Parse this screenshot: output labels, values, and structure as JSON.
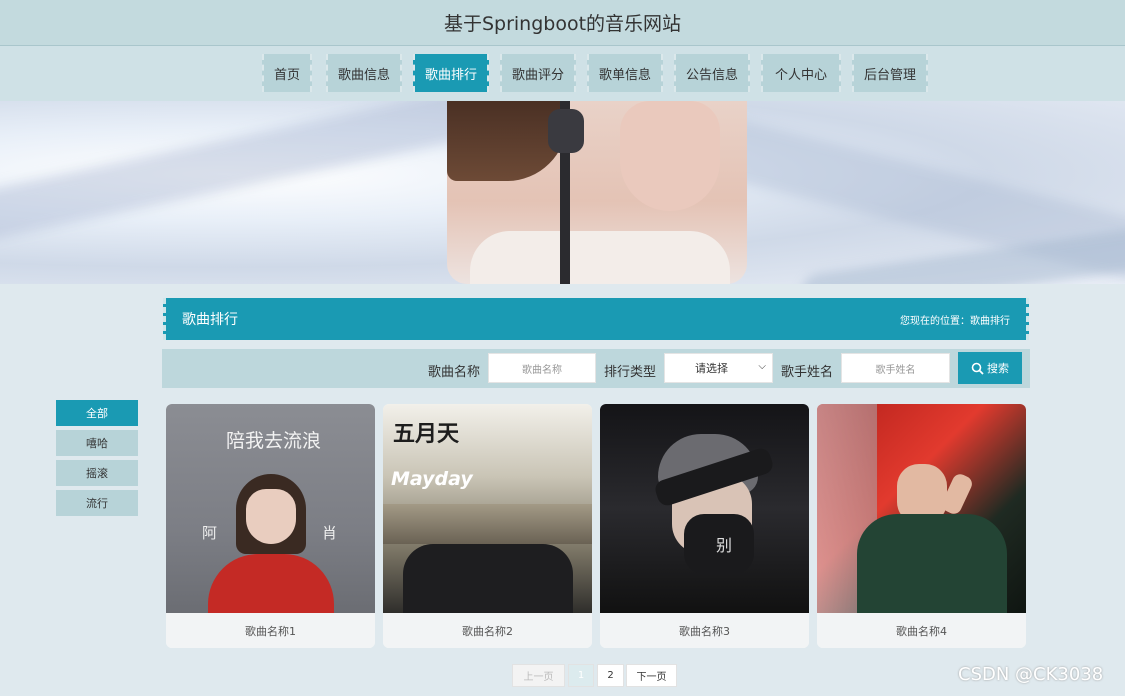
{
  "site": {
    "title": "基于Springboot的音乐网站"
  },
  "nav": {
    "items": [
      "首页",
      "歌曲信息",
      "歌曲排行",
      "歌曲评分",
      "歌单信息",
      "公告信息",
      "个人中心",
      "后台管理"
    ],
    "active": "歌曲排行"
  },
  "section": {
    "title": "歌曲排行",
    "breadcrumb": "您现在的位置：歌曲排行"
  },
  "search": {
    "song_label": "歌曲名称",
    "song_placeholder": "歌曲名称",
    "rank_label": "排行类型",
    "rank_selected": "请选择",
    "singer_label": "歌手姓名",
    "singer_placeholder": "歌手姓名",
    "button_label": "搜索"
  },
  "filters": {
    "items": [
      "全部",
      "嘻哈",
      "摇滚",
      "流行"
    ],
    "active": "全部"
  },
  "songs": [
    {
      "name": "歌曲名称1",
      "cover_text": "陪我去流浪",
      "cover_sub_left": "阿",
      "cover_sub_right": "肖"
    },
    {
      "name": "歌曲名称2",
      "cover_text": "五月天",
      "cover_sub_left": "Mayday",
      "cover_sub_right": ""
    },
    {
      "name": "歌曲名称3",
      "cover_text": "别",
      "cover_sub_left": "",
      "cover_sub_right": ""
    },
    {
      "name": "歌曲名称4",
      "cover_text": "",
      "cover_sub_left": "",
      "cover_sub_right": ""
    }
  ],
  "pagination": {
    "prev": "上一页",
    "pages": [
      "1",
      "2"
    ],
    "current": "1",
    "next": "下一页"
  },
  "watermark": "CSDN @CK3038",
  "colors": {
    "accent": "#1a9ab3",
    "nav_bg": "#b7d3d8",
    "title_bar": "#c3dade"
  }
}
